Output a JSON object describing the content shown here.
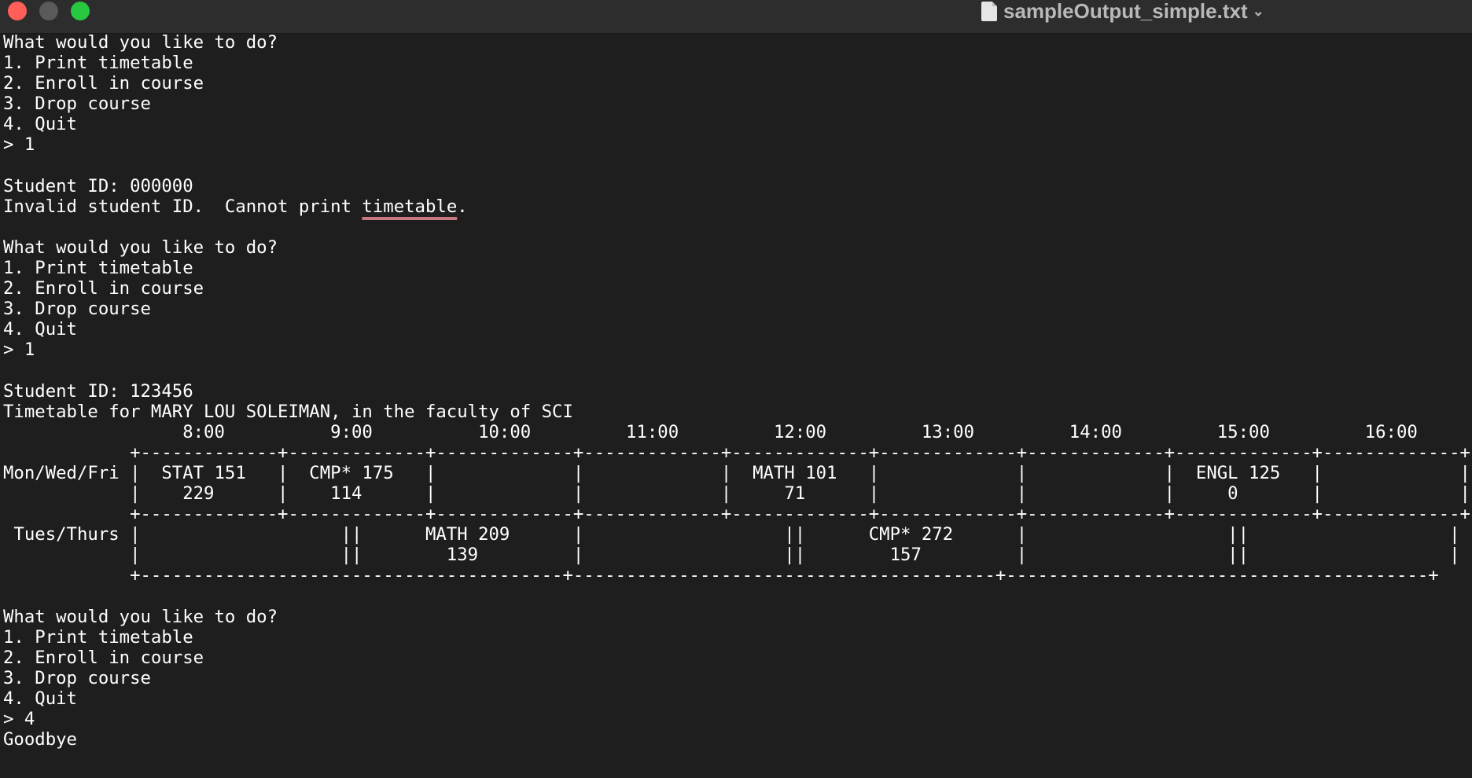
{
  "window": {
    "title": "sampleOutput_simple.txt"
  },
  "icons": {
    "document": "document-icon",
    "chevron": "chevron-down-icon"
  },
  "colors": {
    "background": "#1e1e1e",
    "text": "#ffffff",
    "spellcheck_underline": "#c77880"
  },
  "lines": [
    "What would you like to do?",
    "1. Print timetable",
    "2. Enroll in course",
    "3. Drop course",
    "4. Quit",
    "> 1",
    "",
    "Student ID: 000000",
    "Invalid student ID.  Cannot print ",
    "What would you like to do?",
    "1. Print timetable",
    "2. Enroll in course",
    "3. Drop course",
    "4. Quit",
    "> 1",
    "",
    "Student ID: 123456",
    "Timetable for MARY LOU SOLEIMAN, in the faculty of SCI",
    "                 8:00          9:00          10:00         11:00         12:00         13:00         14:00         15:00         16:00",
    "            +-------------+-------------+-------------+-------------+-------------+-------------+-------------+-------------+-------------+",
    "Mon/Wed/Fri |  STAT 151   |  CMP* 175   |             |             |  MATH 101   |             |             |  ENGL 125   |             |",
    "            |    229      |    114      |             |             |     71      |             |             |     0       |             |",
    "            +-------------+-------------+-------------+-------------+-------------+-------------+-------------+-------------+-------------+",
    " Tues/Thurs |                   ||      MATH 209      |                   ||      CMP* 272      |                   ||                   |",
    "            |                   ||        139         |                   ||        157         |                   ||                   |",
    "            +----------------------------------------+----------------------------------------+----------------------------------------+",
    "",
    "What would you like to do?",
    "1. Print timetable",
    "2. Enroll in course",
    "3. Drop course",
    "4. Quit",
    "> 4",
    "Goodbye"
  ],
  "underlined_word": "timetable",
  "after_underlined": ".",
  "blank": ""
}
